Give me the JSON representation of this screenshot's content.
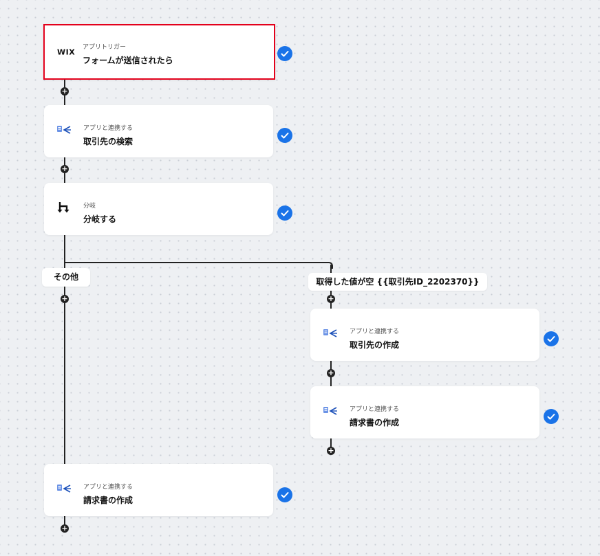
{
  "nodes": {
    "trigger": {
      "logo": "WIX",
      "category": "アプリトリガー",
      "title": "フォームが送信されたら"
    },
    "search_account": {
      "category": "アプリと連携する",
      "title": "取引先の検索"
    },
    "branch": {
      "category": "分岐",
      "title": "分岐する"
    },
    "create_account": {
      "category": "アプリと連携する",
      "title": "取引先の作成"
    },
    "create_invoice_branch": {
      "category": "アプリと連携する",
      "title": "請求書の作成"
    },
    "create_invoice_main": {
      "category": "アプリと連携する",
      "title": "請求書の作成"
    }
  },
  "branch_labels": {
    "other": "その他",
    "empty_condition": "取得した値が空 {{取引先ID_2202370}}"
  },
  "colors": {
    "selected_border": "#e3001b",
    "check_badge": "#1a73e8",
    "connector": "#222222"
  },
  "icons": {
    "app": "accounting-app-icon",
    "branch": "branch-icon",
    "done": "check-circle-icon",
    "add": "plus-icon"
  }
}
